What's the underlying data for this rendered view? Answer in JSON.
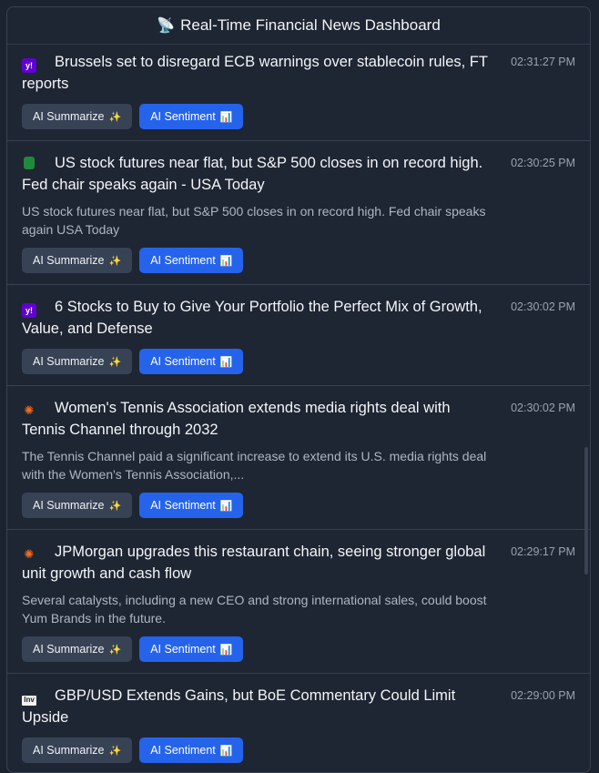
{
  "header": {
    "icon": "satellite-icon",
    "title": "Real-Time Financial News Dashboard"
  },
  "buttons": {
    "summarize_label": "AI Summarize",
    "summarize_icon": "✨",
    "sentiment_label": "AI Sentiment",
    "sentiment_icon": "📊"
  },
  "items": [
    {
      "source_icon": "yahoo-icon",
      "title": "Brussels set to disregard ECB warnings over stablecoin rules, FT reports",
      "time": "02:31:27 PM",
      "description": ""
    },
    {
      "source_icon": "marketwatch-icon",
      "title": "US stock futures near flat, but S&P 500 closes in on record high. Fed chair speaks again - USA Today",
      "time": "02:30:25 PM",
      "description": "US stock futures near flat, but S&P 500 closes in on record high. Fed chair speaks again  USA Today"
    },
    {
      "source_icon": "yahoo-icon",
      "title": "6 Stocks to Buy to Give Your Portfolio the Perfect Mix of Growth, Value, and Defense",
      "time": "02:30:02 PM",
      "description": ""
    },
    {
      "source_icon": "nbc-icon",
      "title": "Women's Tennis Association extends media rights deal with Tennis Channel through 2032",
      "time": "02:30:02 PM",
      "description": "The Tennis Channel paid a significant increase to extend its U.S. media rights deal with the Women's Tennis Association,..."
    },
    {
      "source_icon": "nbc-icon",
      "title": "JPMorgan upgrades this restaurant chain, seeing stronger global unit growth and cash flow",
      "time": "02:29:17 PM",
      "description": "Several catalysts, including a new CEO and strong international sales, could boost Yum Brands in the future."
    },
    {
      "source_icon": "investing-icon",
      "title": "GBP/USD Extends Gains, but BoE Commentary Could Limit Upside",
      "time": "02:29:00 PM",
      "description": ""
    }
  ]
}
